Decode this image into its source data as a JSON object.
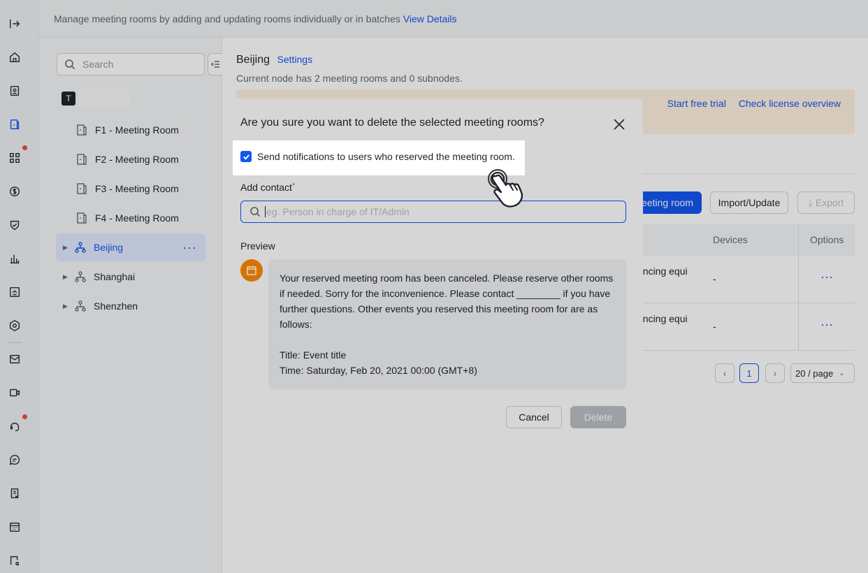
{
  "banner": {
    "text": "Manage meeting rooms by adding and updating rooms individually or in batches",
    "link": "View Details"
  },
  "rail_icons": [
    "sidebar-toggle-icon",
    "home-icon",
    "contacts-icon",
    "meeting-room-icon",
    "apps-icon",
    "billing-icon",
    "security-icon",
    "analytics-icon",
    "workplace-icon",
    "settings-hex-icon",
    "mail-icon",
    "video-icon",
    "support-icon",
    "chat-icon",
    "approval-icon",
    "calendar-icon",
    "search-doc-icon"
  ],
  "tree": {
    "search_placeholder": "Search",
    "tenant_initial": "T",
    "rooms": [
      "F1 - Meeting Room",
      "F2 - Meeting Room",
      "F3 - Meeting Room",
      "F4 - Meeting Room"
    ],
    "nodes": [
      "Beijing",
      "Shanghai",
      "Shenzhen"
    ],
    "selected": "Beijing"
  },
  "main": {
    "title": "Beijing",
    "settings_link": "Settings",
    "subtitle": "Current node has 2 meeting rooms and 0 subnodes.",
    "notice_links": [
      "Start free trial",
      "Check license overview"
    ],
    "add_button": "eeting room",
    "import_button": "Import/Update",
    "export_button": "Export",
    "table": {
      "headers": [
        "Devices",
        "Options"
      ],
      "rows": [
        {
          "partial": "encing equi",
          "devices": "-",
          "options": "···"
        },
        {
          "partial": "encing equi",
          "devices": "-",
          "options": "···"
        }
      ]
    },
    "pagination": {
      "current": "1",
      "page_size": "20 / page"
    }
  },
  "dialog": {
    "title": "Are you sure you want to delete the selected meeting rooms?",
    "checkbox_label": "Send notifications to users who reserved the meeting room.",
    "checkbox_checked": true,
    "contact_label": "Add contact",
    "required_mark": "*",
    "contact_placeholder": "eg. Person in charge of IT/Admin",
    "preview_label": "Preview",
    "preview_lines": [
      "Your reserved meeting room has been canceled. Please reserve other rooms",
      "if needed. Sorry for the inconvenience. Please contact ________ if you have",
      "further questions. Other events you reserved this meeting room for are as",
      "follows:"
    ],
    "preview_event_title": "Title: Event title",
    "preview_event_time": "Time: Saturday, Feb 20, 2021 00:00 (GMT+8)",
    "cancel_label": "Cancel",
    "delete_label": "Delete"
  },
  "colors": {
    "accent": "#1456f0",
    "avatar": "#ff8800",
    "notice_bg": "#fef1e1",
    "danger_dot": "#f54a45"
  }
}
